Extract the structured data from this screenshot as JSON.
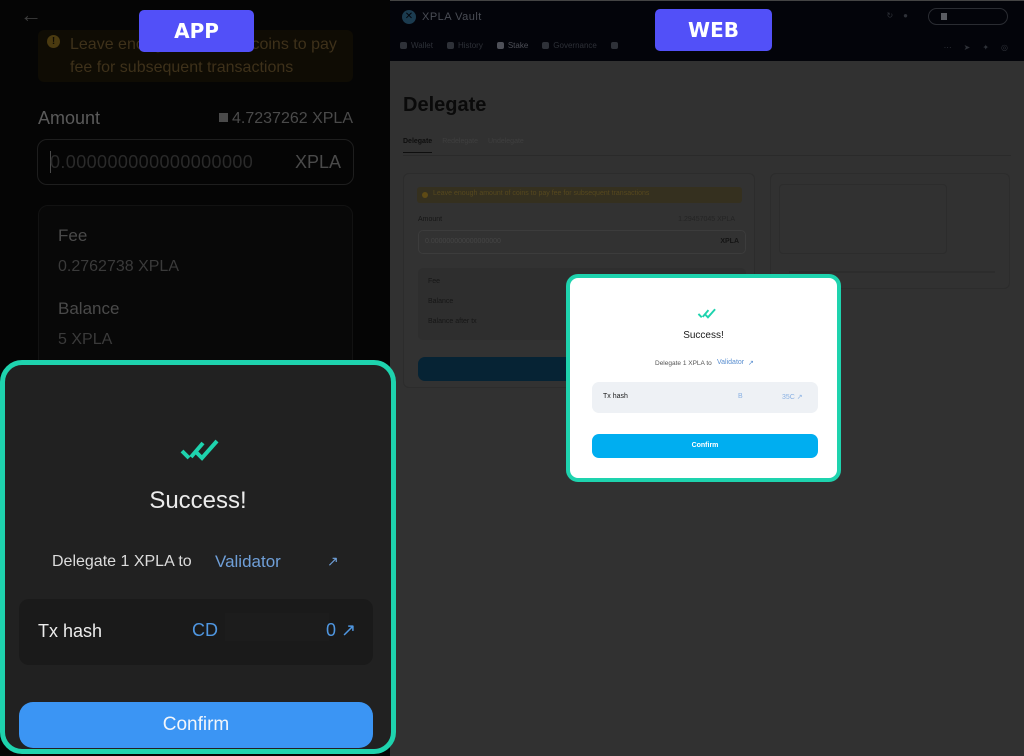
{
  "labels": {
    "app": "APP",
    "web": "WEB"
  },
  "colors": {
    "accent_teal": "#1ed3ae",
    "label_purple": "#5250f8",
    "app_confirm": "#3b95f4",
    "web_confirm": "#00aef0",
    "link_blue": "#4f96e0"
  },
  "app": {
    "back_icon": "←",
    "warning": {
      "icon": "info-icon",
      "text": "Leave enough amount of coins to pay fee for subsequent transactions"
    },
    "amount": {
      "label": "Amount",
      "balance": "4.7237262 XPLA",
      "placeholder": "0.000000000000000000",
      "unit": "XPLA"
    },
    "fee_card": {
      "fee_label": "Fee",
      "fee_value": "0.2762738 XPLA",
      "balance_label": "Balance",
      "balance_value": "5 XPLA"
    },
    "modal": {
      "icon": "double-check-icon",
      "title": "Success!",
      "delegate_text": "Delegate 1 XPLA to",
      "validator_link": "Validator",
      "external_link_icon": "↗",
      "tx_hash_label": "Tx hash",
      "tx_hash_prefix": "CD",
      "tx_hash_suffix": "0 ↗",
      "confirm_label": "Confirm"
    }
  },
  "web": {
    "brand": "XPLA Vault",
    "nav": [
      {
        "label": "Wallet",
        "active": false
      },
      {
        "label": "History",
        "active": false
      },
      {
        "label": "Stake",
        "active": true
      },
      {
        "label": "Governance",
        "active": false
      }
    ],
    "header_icons": [
      "↻",
      "●"
    ],
    "social_icons": [
      "⋯",
      "➤",
      "✦",
      "◎"
    ],
    "page_title": "Delegate",
    "tabs": [
      {
        "label": "Delegate",
        "active": true
      },
      {
        "label": "Redelegate",
        "active": false
      },
      {
        "label": "Undelegate",
        "active": false
      }
    ],
    "form": {
      "warning": "Leave enough amount of coins to pay fee for subsequent transactions",
      "amount_label": "Amount",
      "amount_balance": "1.29457045 XPLA",
      "amount_placeholder": "0.000000000000000000",
      "amount_unit": "XPLA",
      "fee_label": "Fee",
      "balance_label": "Balance",
      "balance_after_label": "Balance after tx"
    },
    "modal": {
      "title": "Success!",
      "delegate_text": "Delegate 1 XPLA to",
      "validator_link": "Validator",
      "external_link_icon": "↗",
      "tx_hash_label": "Tx hash",
      "tx_hash_prefix": "B",
      "tx_hash_suffix": "35C ↗",
      "confirm_label": "Confirm"
    }
  }
}
